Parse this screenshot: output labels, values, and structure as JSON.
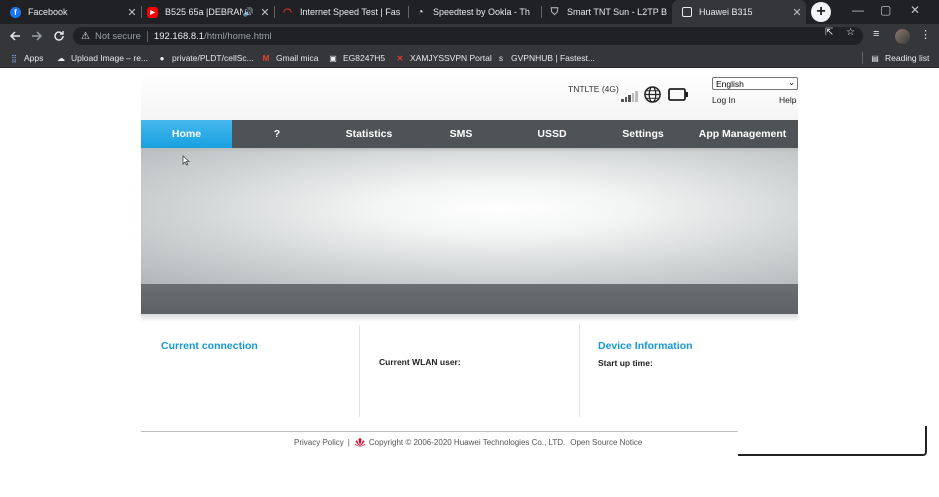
{
  "browser": {
    "tabs": [
      {
        "title": "Facebook",
        "icon": "facebook-icon",
        "color": "#1877f2",
        "glyph": "f"
      },
      {
        "title": "B525 65a |DEBRAND",
        "icon": "youtube-icon",
        "color": "#ff0000",
        "glyph": "▶",
        "audio": "🔊"
      },
      {
        "title": "Internet Speed Test | Fas",
        "icon": "speedtest-icon",
        "color": "#e2342a",
        "glyph": "◠"
      },
      {
        "title": "Speedtest by Ookla - Th",
        "icon": "ookla-icon",
        "color": "#e8eaed",
        "glyph": "◔"
      },
      {
        "title": "Smart TNT Sun - L2TP B",
        "icon": "shield-icon",
        "color": "#c0c0c0",
        "glyph": "⛉"
      },
      {
        "title": "Huawei B315",
        "icon": "huawei-tab-icon",
        "color": "#e8eaed",
        "glyph": "◙"
      }
    ],
    "close_glyph": "✕",
    "new_tab_glyph": "+",
    "omnibox": {
      "security_icon": "warning-icon",
      "security_text": "Not secure",
      "host": "192.168.8.1",
      "path": "/html/home.html"
    },
    "bookmarks": [
      {
        "label": "Apps",
        "icon": "apps-grid-icon",
        "glyph": "⣿"
      },
      {
        "label": "Upload Image – re...",
        "icon": "cloud-icon",
        "glyph": "☁"
      },
      {
        "label": "private/PLDT/cellSc...",
        "icon": "github-icon",
        "glyph": "●"
      },
      {
        "label": "Gmail mica",
        "icon": "gmail-icon",
        "glyph": "M"
      },
      {
        "label": "EG8247H5",
        "icon": "router-icon",
        "glyph": "▣"
      },
      {
        "label": "XAMJYSSVPN Portal",
        "icon": "vpn-icon",
        "glyph": "✕"
      },
      {
        "label": "GVPNHUB | Fastest...",
        "icon": "gvpn-icon",
        "glyph": "s"
      }
    ],
    "reading_list": "Reading list"
  },
  "router": {
    "network": "TNTLTE (4G)",
    "signal_bars": 5,
    "signal_level": 3,
    "language": "English",
    "login": "Log In",
    "help": "Help",
    "menu": [
      {
        "label": "Home",
        "active": true
      },
      {
        "label": "?"
      },
      {
        "label": "Statistics"
      },
      {
        "label": "SMS"
      },
      {
        "label": "USSD"
      },
      {
        "label": "Settings"
      },
      {
        "label": "App Management"
      }
    ],
    "sections": {
      "connection_title": "Current connection",
      "wlan_label": "Current WLAN user:",
      "device_title": "Device Information",
      "uptime_label": "Start up time:"
    },
    "footer": {
      "privacy": "Privacy Policy",
      "separator": "|",
      "copyright": "Copyright © 2006-2020 Huawei Technologies Co., LTD.",
      "open_source": "Open Source Notice"
    }
  },
  "colors": {
    "accent_blue": "#1598d6",
    "menu_bg": "#4d5356",
    "menu_active": "#17a0e0"
  }
}
